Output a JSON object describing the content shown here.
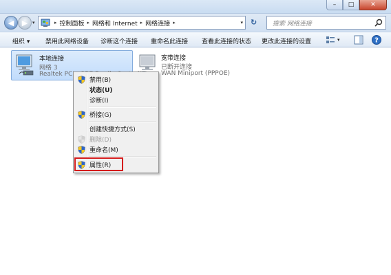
{
  "window": {
    "min_glyph": "–",
    "max_glyph": "□",
    "close_glyph": "✕"
  },
  "address": {
    "crumbs": [
      "控制面板",
      "网络和 Internet",
      "网络连接"
    ],
    "separator": "▸",
    "dropdown": "▾"
  },
  "navigation": {
    "back_glyph": "◀",
    "forward_glyph": "▶",
    "history_dropdown": "▾",
    "refresh_glyph": "↻"
  },
  "search": {
    "placeholder": "搜索 网络连接"
  },
  "toolbar": {
    "organize": "组织 ▾",
    "disable_device": "禁用此网络设备",
    "diagnose": "诊断这个连接",
    "rename": "重命名此连接",
    "view_status": "查看此连接的状态",
    "change_settings": "更改此连接的设置",
    "view_dropdown": "▾"
  },
  "connections": [
    {
      "name": "本地连接",
      "network": "网络  3",
      "adapter": "Realtek PCIe GBE Family Controller",
      "selected": true
    },
    {
      "name": "宽带连接",
      "network": "已断开连接",
      "adapter": "WAN Miniport (PPPOE)",
      "selected": false
    }
  ],
  "context_menu": {
    "items": [
      {
        "label": "禁用(B)",
        "shield": true,
        "bold": false,
        "disabled": false
      },
      {
        "label": "状态(U)",
        "shield": false,
        "bold": true,
        "disabled": false
      },
      {
        "label": "诊断(I)",
        "shield": false,
        "bold": false,
        "disabled": false
      },
      {
        "label": "桥接(G)",
        "shield": true,
        "bold": false,
        "disabled": false
      },
      {
        "label": "创建快捷方式(S)",
        "shield": false,
        "bold": false,
        "disabled": false
      },
      {
        "label": "删除(D)",
        "shield": true,
        "bold": false,
        "disabled": true
      },
      {
        "label": "重命名(M)",
        "shield": true,
        "bold": false,
        "disabled": false
      },
      {
        "label": "属性(R)",
        "shield": true,
        "bold": false,
        "disabled": false,
        "highlighted": true
      }
    ]
  },
  "colors": {
    "highlight_border": "#d41c1c",
    "selection_bg": "#c1dcfc",
    "shield_blue": "#2f66c7",
    "shield_yellow": "#f3c623"
  }
}
